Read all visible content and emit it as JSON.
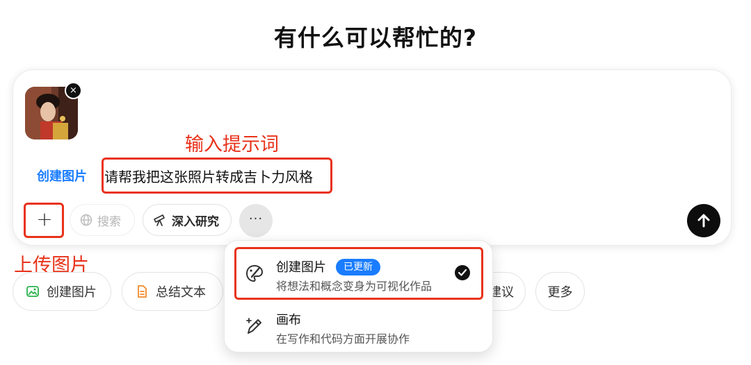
{
  "heading": "有什么可以帮忙的?",
  "composer": {
    "mode_label": "创建图片",
    "prompt": "请帮我把这张照片转成吉卜力风格",
    "attachment_close": "×",
    "plus": "+",
    "search_label": "搜索",
    "research_label": "深入研究",
    "more": "···"
  },
  "annotations": {
    "prompt": "输入提示词",
    "upload": "上传图片"
  },
  "quick_actions": [
    {
      "label": "创建图片",
      "icon": "image-icon",
      "color": "#2bb24c"
    },
    {
      "label": "总结文本",
      "icon": "document-icon",
      "color": "#f08a2a"
    },
    {
      "label": "建议"
    },
    {
      "label": "更多"
    }
  ],
  "menu": {
    "items": [
      {
        "title": "创建图片",
        "badge": "已更新",
        "description": "将想法和概念变身为可视化作品",
        "icon": "palette-icon",
        "selected": true
      },
      {
        "title": "画布",
        "description": "在写作和代码方面开展协作",
        "icon": "pen-sparkle-icon"
      }
    ]
  },
  "colors": {
    "accent": "#1a7cff",
    "annotation": "#e8321a"
  }
}
